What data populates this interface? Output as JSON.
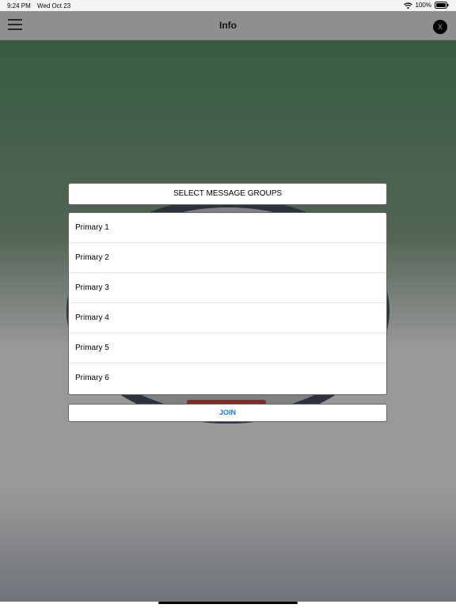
{
  "status_bar": {
    "time": "9:24 PM",
    "date": "Wed Oct 23",
    "battery": "100%",
    "wifi_icon": "wifi-icon",
    "battery_icon": "battery-icon"
  },
  "nav": {
    "title": "Info",
    "menu_icon": "hamburger-menu-icon",
    "close_label": "X"
  },
  "dialog": {
    "header": "SELECT MESSAGE GROUPS",
    "groups": [
      {
        "label": "Primary 1"
      },
      {
        "label": "Primary 2"
      },
      {
        "label": "Primary 3"
      },
      {
        "label": "Primary 4"
      },
      {
        "label": "Primary 5"
      },
      {
        "label": "Primary 6"
      }
    ],
    "join_label": "JOIN"
  },
  "colors": {
    "accent": "#1e7bf0",
    "overlay": "rgba(0,0,0,0.4)"
  }
}
